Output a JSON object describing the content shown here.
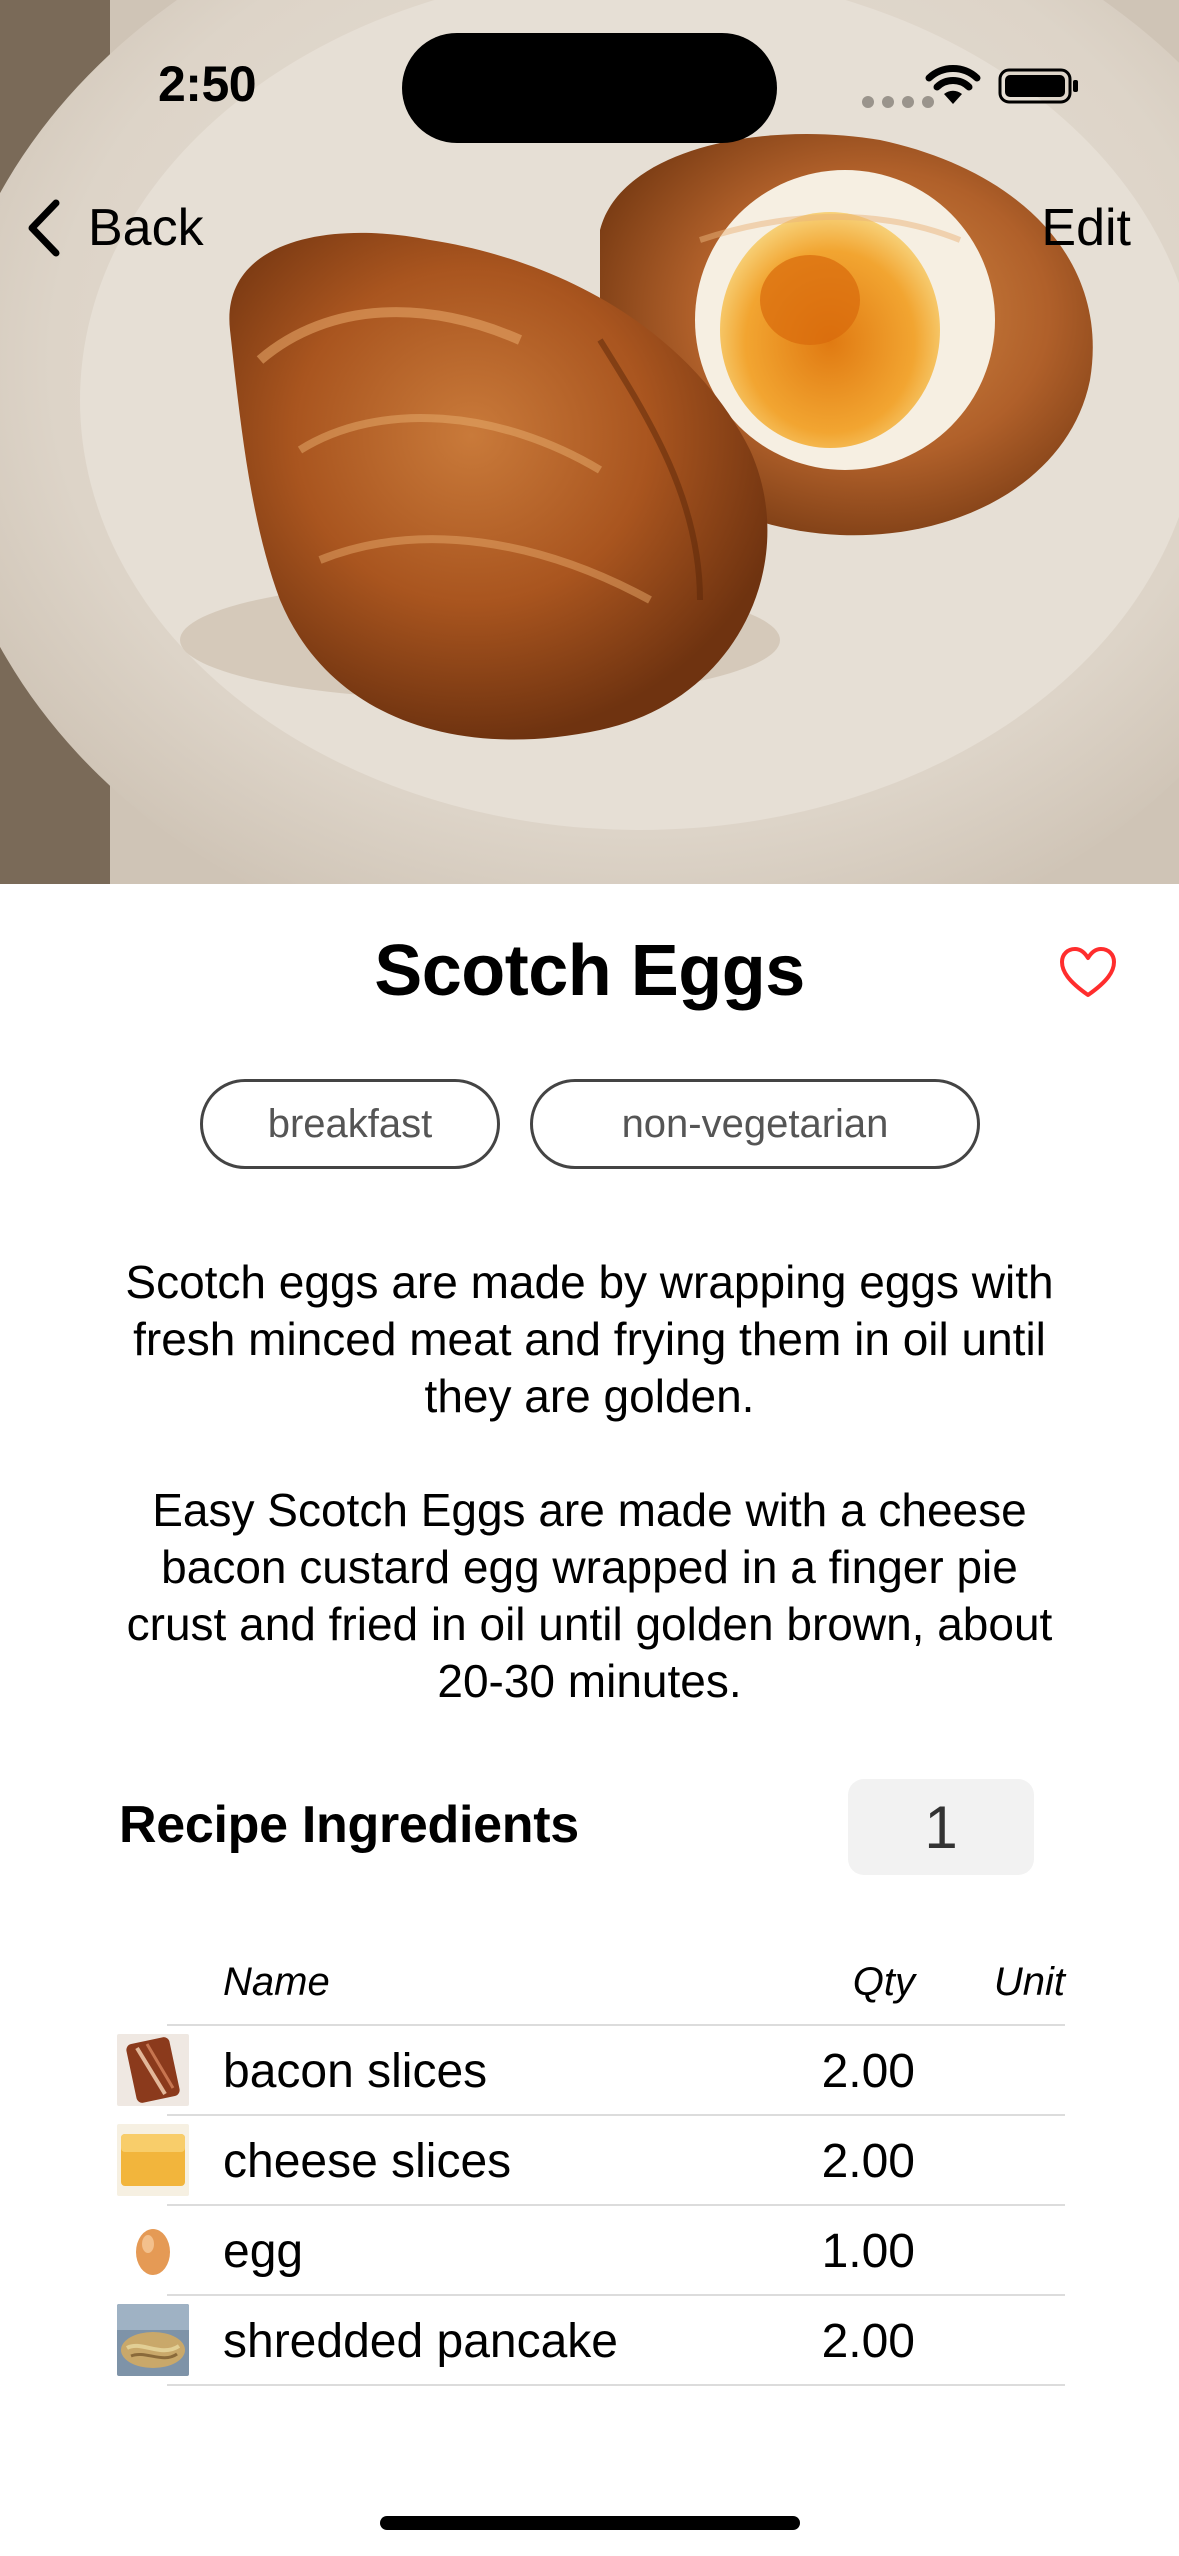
{
  "status_bar": {
    "time": "2:50"
  },
  "nav": {
    "back_label": "Back",
    "edit_label": "Edit"
  },
  "recipe": {
    "title": "Scotch Eggs",
    "favorite_icon": "heart-outline-icon",
    "favorite_color": "#ff2d2d",
    "tags": [
      "breakfast",
      "non-vegetarian"
    ],
    "description": [
      "Scotch eggs are made by wrapping eggs with fresh minced meat and frying them in oil until they are golden.",
      "Easy Scotch Eggs are made with a cheese bacon custard egg wrapped in a finger pie crust and fried in oil until golden brown, about 20-30 minutes."
    ]
  },
  "ingredients": {
    "heading": "Recipe Ingredients",
    "servings": "1",
    "columns": {
      "name": "Name",
      "qty": "Qty",
      "unit": "Unit"
    },
    "rows": [
      {
        "name": "bacon slices",
        "qty": "2.00",
        "unit": "",
        "thumb": "bacon"
      },
      {
        "name": "cheese slices",
        "qty": "2.00",
        "unit": "",
        "thumb": "cheese"
      },
      {
        "name": "egg",
        "qty": "1.00",
        "unit": "",
        "thumb": "egg"
      },
      {
        "name": "shredded pancake",
        "qty": "2.00",
        "unit": "",
        "thumb": "pancake"
      }
    ]
  }
}
